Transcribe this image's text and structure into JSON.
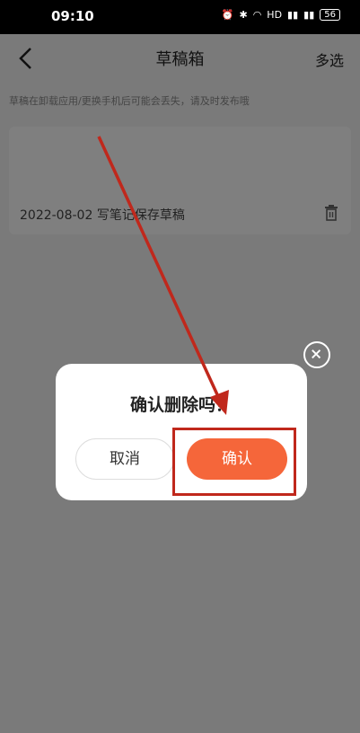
{
  "status_bar": {
    "time": "09:10",
    "icons": [
      "alarm-icon",
      "bluetooth-icon",
      "wifi-icon",
      "hd-icon",
      "signal-icon",
      "signal-icon"
    ],
    "hd_label": "HD",
    "battery": "56"
  },
  "nav": {
    "title": "草稿箱",
    "multi_select": "多选"
  },
  "hint": "草稿在卸载应用/更换手机后可能会丢失，请及时发布哦",
  "draft": {
    "date": "2022-08-02",
    "text": "写笔记保存草稿"
  },
  "dialog": {
    "title": "确认删除吗？",
    "cancel": "取消",
    "confirm": "确认"
  },
  "colors": {
    "accent": "#f5663a",
    "annotation": "#c0281c"
  }
}
